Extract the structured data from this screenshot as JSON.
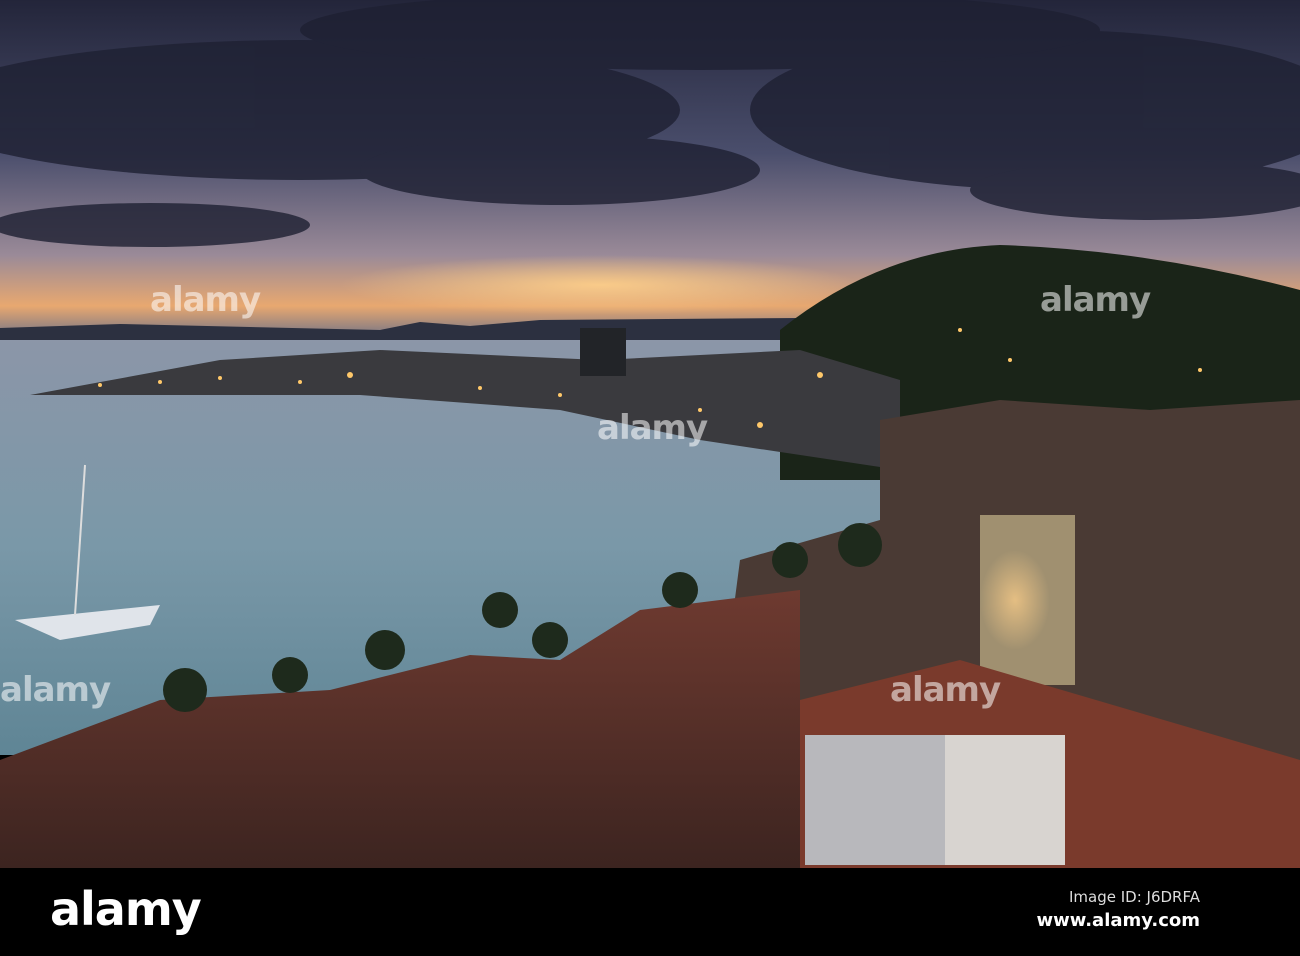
{
  "photo": {
    "subject": "Split harbour at dusk",
    "colors": {
      "sky_top": "#2a2d45",
      "sky_glow": "#f0b070",
      "water": "#7f97a6",
      "hill": "#1c2618",
      "roof": "#8a3a2a",
      "light": "#ffc86a"
    }
  },
  "watermark": {
    "text": "alamy"
  },
  "footer": {
    "logo": "alamy",
    "image_id": "Image ID: J6DRFA",
    "website": "www.alamy.com"
  }
}
